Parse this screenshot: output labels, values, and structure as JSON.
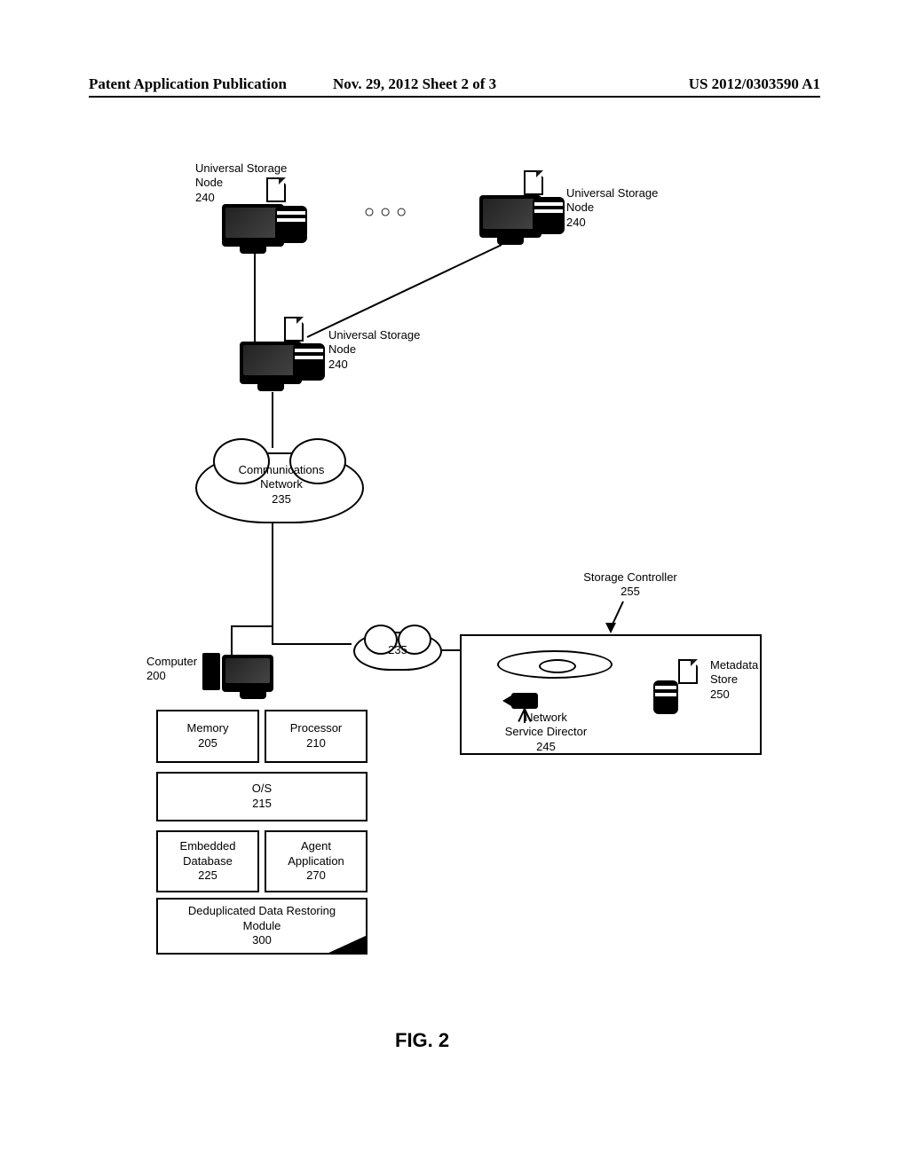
{
  "header": {
    "left": "Patent Application Publication",
    "center": "Nov. 29, 2012  Sheet 2 of 3",
    "right": "US 2012/0303590 A1"
  },
  "figure_caption": "FIG. 2",
  "nodes": {
    "usn_left": {
      "label": "Universal Storage",
      "label2": "Node",
      "ref": "240"
    },
    "usn_right": {
      "label": "Universal Storage",
      "label2": "Node",
      "ref": "240"
    },
    "usn_mid": {
      "label": "Universal Storage",
      "label2": "Node",
      "ref": "240"
    },
    "dots": "○○○",
    "cloud_main": {
      "label": "Communications",
      "label2": "Network",
      "ref": "235"
    },
    "cloud_small_ref": "235",
    "computer": {
      "label": "Computer",
      "ref": "200"
    },
    "memory": {
      "label": "Memory",
      "ref": "205"
    },
    "processor": {
      "label": "Processor",
      "ref": "210"
    },
    "os": {
      "label": "O/S",
      "ref": "215"
    },
    "embedded": {
      "label": "Embedded",
      "label2": "Database",
      "ref": "225"
    },
    "agent": {
      "label": "Agent",
      "label2": "Application",
      "ref": "270"
    },
    "dedup": {
      "label": "Deduplicated Data Restoring",
      "label2": "Module",
      "ref": "300"
    },
    "storage_controller": {
      "label": "Storage Controller",
      "ref": "255"
    },
    "metadata_store": {
      "label": "Metadata",
      "label2": "Store",
      "ref": "250"
    },
    "nsd": {
      "label": "Network",
      "label2": "Service Director",
      "ref": "245"
    }
  }
}
